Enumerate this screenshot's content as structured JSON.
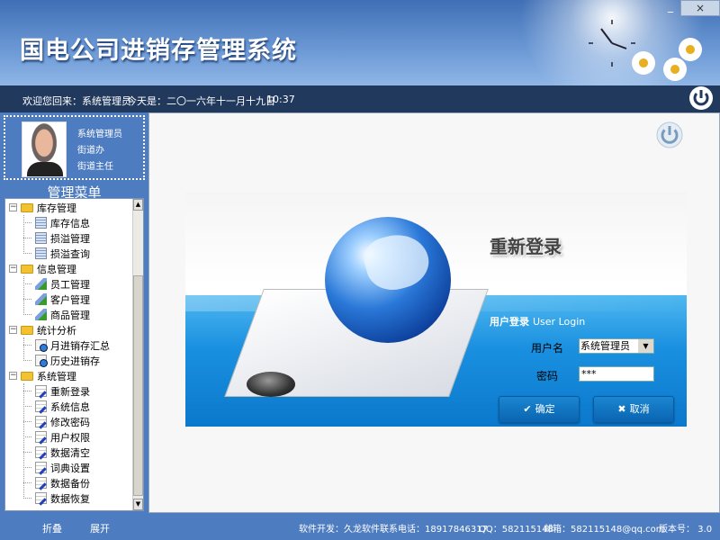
{
  "header": {
    "title": "国电公司进销存管理系统",
    "close_label": "×",
    "min_label": "_"
  },
  "infobar": {
    "welcome": "欢迎您回来：系统管理员",
    "date": "今天是：二〇一六年十一月十九日",
    "time": "10:37"
  },
  "profile": {
    "role": "系统管理员",
    "department": "街道办",
    "position": "街道主任"
  },
  "menu": {
    "title": "管理菜单",
    "groups": [
      {
        "label": "库存管理",
        "icon": "table-icon",
        "items": [
          "库存信息",
          "损溢管理",
          "损溢查询"
        ]
      },
      {
        "label": "信息管理",
        "icon": "pencil-icon",
        "items": [
          "员工管理",
          "客户管理",
          "商品管理"
        ]
      },
      {
        "label": "统计分析",
        "icon": "report-search-icon",
        "items": [
          "月进销存汇总",
          "历史进销存"
        ]
      },
      {
        "label": "系统管理",
        "icon": "notepad-edit-icon",
        "items": [
          "重新登录",
          "系统信息",
          "修改密码",
          "用户权限",
          "数据清空",
          "词典设置",
          "数据备份",
          "数据恢复"
        ]
      }
    ]
  },
  "bottom": {
    "collapse": "折叠",
    "expand": "展开",
    "developer": "软件开发：久龙软件",
    "phone": "联系电话：18917846317",
    "qq": "QQ：582115148",
    "email": "邮箱：582115148@qq.com",
    "version": "版本号： 3.0"
  },
  "login": {
    "title": "重新登录",
    "header_cn": "用户登录",
    "header_en": "User Login",
    "username_label": "用户名",
    "username_value": "系统管理员",
    "password_label": "密码",
    "password_value": "***",
    "ok_label": "确定",
    "cancel_label": "取消"
  },
  "colors": {
    "panel_blue": "#4e7cc0",
    "infobar": "#22395e",
    "button": "#0a64b0"
  }
}
